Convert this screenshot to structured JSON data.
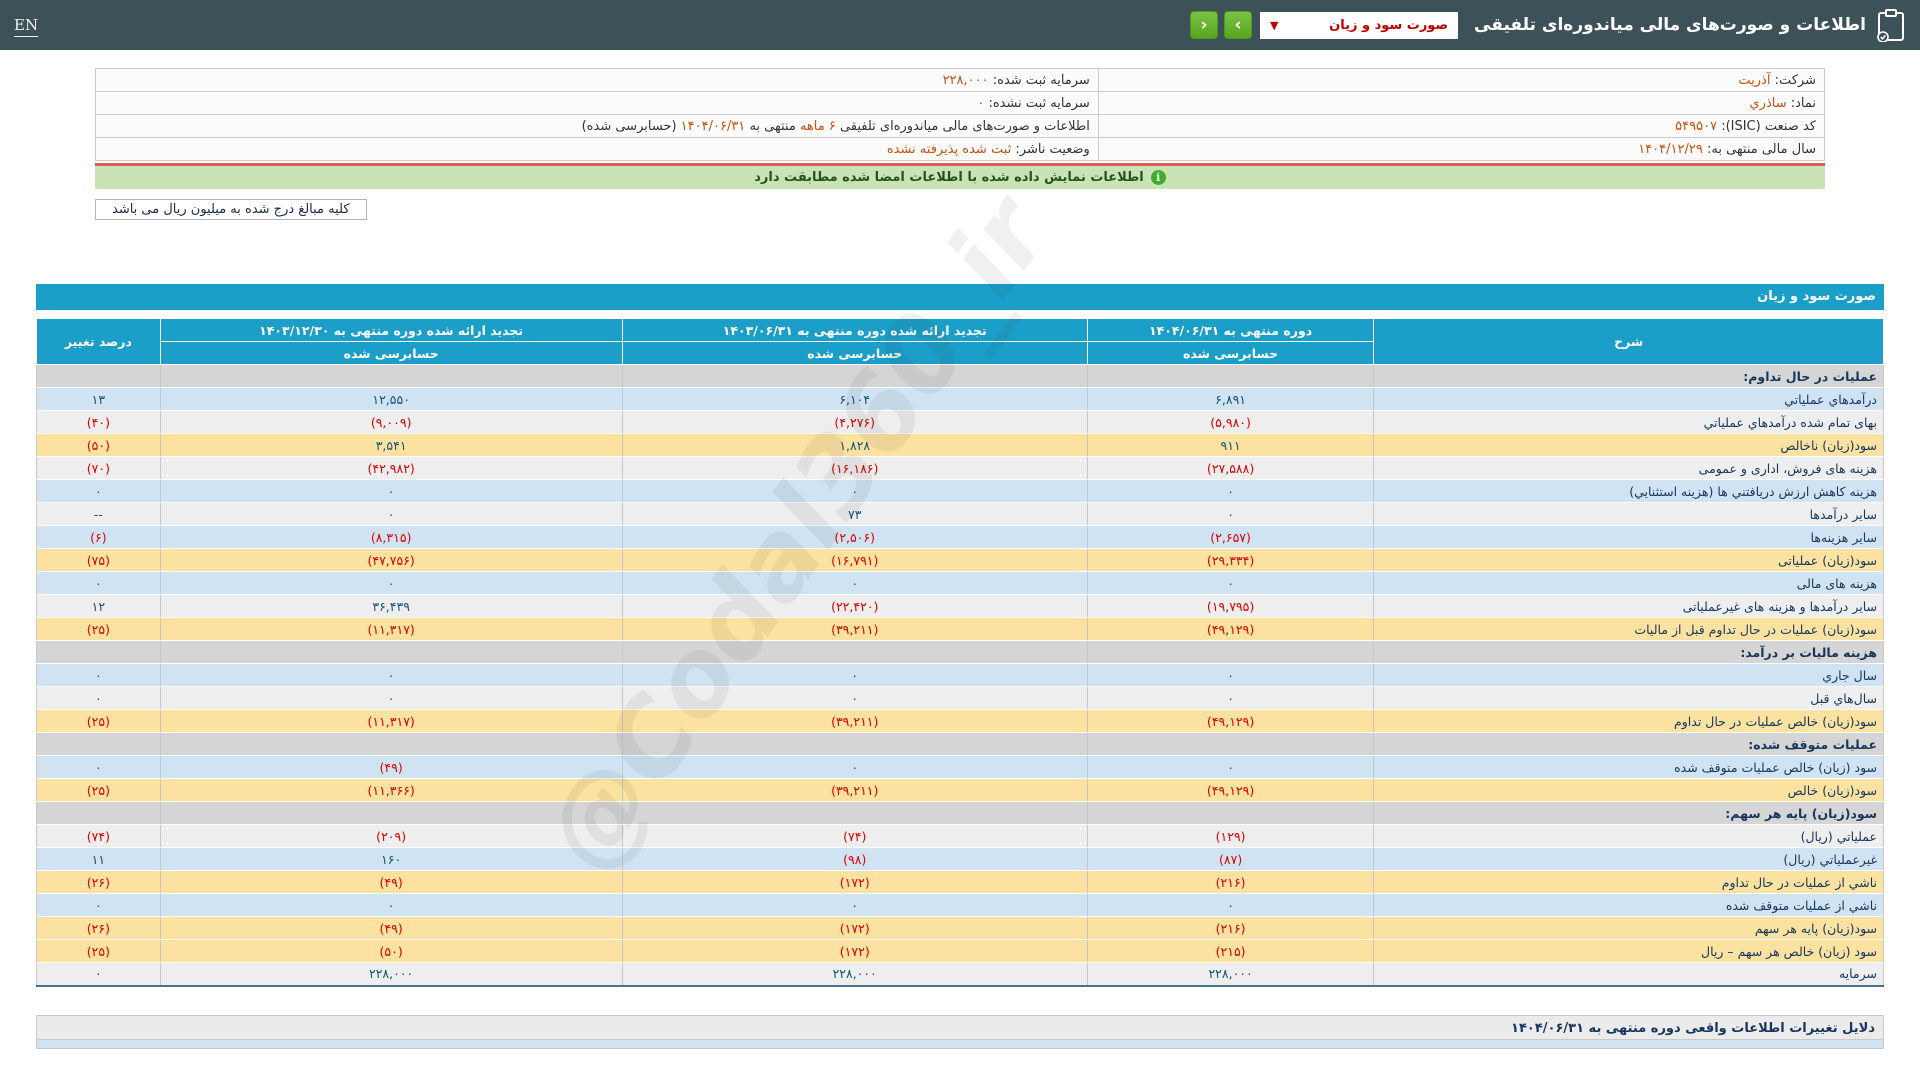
{
  "topbar": {
    "en_link": "EN",
    "title": "اطلاعات و صورت‌های مالی میاندوره‌ای تلفیقی",
    "statement_select": "صورت سود و زیان",
    "dropdown_arrow": "▼",
    "next_arrow": "›",
    "prev_arrow": "‹"
  },
  "info": {
    "company_label": "شرکت:",
    "company_value": "آذریت",
    "symbol_label": "نماد:",
    "symbol_value": "ساذري",
    "isic_label": "کد صنعت (ISIC):",
    "isic_value": "۵۴۹۵۰۷",
    "fiscal_year_label": "سال مالی منتهی به:",
    "fiscal_year_value": "۱۴۰۴/۱۲/۲۹",
    "registered_capital_label": "سرمایه ثبت شده:",
    "registered_capital_value": "۲۲۸,۰۰۰",
    "unregistered_capital_label": "سرمایه ثبت نشده:",
    "unregistered_capital_value": "۰",
    "report_title_prefix": "اطلاعات و صورت‌های مالی میاندوره‌ای تلفیقی",
    "report_period": "۶ ماهه",
    "report_mid": "منتهی به",
    "report_date": "۱۴۰۴/۰۶/۳۱",
    "report_suffix": "(حسابرسی شده)",
    "publisher_status_label": "وضعیت ناشر:",
    "publisher_status_value": "ثبت شده پذیرفته نشده"
  },
  "banner": {
    "info_icon": "i",
    "text": "اطلاعات نمایش داده شده با اطلاعات امضا شده مطابقت دارد"
  },
  "note": {
    "text": "کلیه مبالغ درج شده به میلیون ریال می باشد"
  },
  "watermark": "@Codal360_ir",
  "table": {
    "title": "صورت سود و زیان",
    "audited": "حسابرسی شده",
    "columns": {
      "description": "شرح",
      "current": "دوره منتهی به ۱۴۰۴/۰۶/۳۱",
      "restated_mid": "تجدید ارائه شده دوره منتهی به ۱۴۰۳/۰۶/۳۱",
      "restated_year": "تجدید ارائه شده دوره منتهی به ۱۴۰۳/۱۲/۳۰",
      "pct_change": "درصد تغییر"
    },
    "rows": [
      {
        "label": "عملیات در حال تداوم:",
        "v1": "",
        "v2": "",
        "v3": "",
        "pct": "",
        "variant": "section"
      },
      {
        "label": "درآمدهاي عملياتي",
        "v1": "۶,۸۹۱",
        "v2": "۶,۱۰۴",
        "v3": "۱۲,۵۵۰",
        "pct": "۱۳",
        "variant": "blue"
      },
      {
        "label": "بهای تمام شده درآمدهاي عملياتي",
        "v1": "(۵,۹۸۰)",
        "v2": "(۴,۲۷۶)",
        "v3": "(۹,۰۰۹)",
        "pct": "(۴۰)",
        "variant": "gray"
      },
      {
        "label": "سود(زيان) ناخالص",
        "v1": "۹۱۱",
        "v2": "۱,۸۲۸",
        "v3": "۳,۵۴۱",
        "pct": "(۵۰)",
        "variant": "yellow"
      },
      {
        "label": "هزينه های فروش، اداری و عمومی",
        "v1": "(۲۷,۵۸۸)",
        "v2": "(۱۶,۱۸۶)",
        "v3": "(۴۲,۹۸۲)",
        "pct": "(۷۰)",
        "variant": "gray"
      },
      {
        "label": "هزينه کاهش ارزش دريافتني ها (هزينه استثنايي)",
        "v1": "۰",
        "v2": "۰",
        "v3": "۰",
        "pct": "۰",
        "variant": "blue"
      },
      {
        "label": "ساير درآمدها",
        "v1": "۰",
        "v2": "۷۳",
        "v3": "۰",
        "pct": "--",
        "variant": "gray"
      },
      {
        "label": "ساير هزينه‌ها",
        "v1": "(۲,۶۵۷)",
        "v2": "(۲,۵۰۶)",
        "v3": "(۸,۳۱۵)",
        "pct": "(۶)",
        "variant": "blue"
      },
      {
        "label": "سود(زيان) عملياتی",
        "v1": "(۲۹,۳۳۴)",
        "v2": "(۱۶,۷۹۱)",
        "v3": "(۴۷,۷۵۶)",
        "pct": "(۷۵)",
        "variant": "yellow"
      },
      {
        "label": "هزينه های مالی",
        "v1": "۰",
        "v2": "۰",
        "v3": "۰",
        "pct": "۰",
        "variant": "blue"
      },
      {
        "label": "ساير درآمدها و هزينه های غيرعملياتی",
        "v1": "(۱۹,۷۹۵)",
        "v2": "(۲۲,۴۲۰)",
        "v3": "۳۶,۴۳۹",
        "pct": "۱۲",
        "variant": "gray"
      },
      {
        "label": "سود(زيان) عمليات در حال تداوم قبل از ماليات",
        "v1": "(۴۹,۱۲۹)",
        "v2": "(۳۹,۲۱۱)",
        "v3": "(۱۱,۳۱۷)",
        "pct": "(۲۵)",
        "variant": "yellow"
      },
      {
        "label": "هزينه ماليات بر درآمد:",
        "v1": "",
        "v2": "",
        "v3": "",
        "pct": "",
        "variant": "section"
      },
      {
        "label": "سال جاري",
        "v1": "۰",
        "v2": "۰",
        "v3": "۰",
        "pct": "۰",
        "variant": "blue"
      },
      {
        "label": "سال‌هاي قبل",
        "v1": "۰",
        "v2": "۰",
        "v3": "۰",
        "pct": "۰",
        "variant": "gray"
      },
      {
        "label": "سود(زيان) خالص عمليات در حال تداوم",
        "v1": "(۴۹,۱۲۹)",
        "v2": "(۳۹,۲۱۱)",
        "v3": "(۱۱,۳۱۷)",
        "pct": "(۲۵)",
        "variant": "yellow"
      },
      {
        "label": "عمليات متوقف شده:",
        "v1": "",
        "v2": "",
        "v3": "",
        "pct": "",
        "variant": "section"
      },
      {
        "label": "سود (زيان) خالص عمليات متوقف شده",
        "v1": "۰",
        "v2": "۰",
        "v3": "(۴۹)",
        "pct": "۰",
        "variant": "blue"
      },
      {
        "label": "سود(زيان) خالص",
        "v1": "(۴۹,۱۲۹)",
        "v2": "(۳۹,۲۱۱)",
        "v3": "(۱۱,۳۶۶)",
        "pct": "(۲۵)",
        "variant": "yellow"
      },
      {
        "label": "سود(زيان) پايه هر سهم:",
        "v1": "",
        "v2": "",
        "v3": "",
        "pct": "",
        "variant": "section"
      },
      {
        "label": "عملياتي (ريال)",
        "v1": "(۱۲۹)",
        "v2": "(۷۴)",
        "v3": "(۲۰۹)",
        "pct": "(۷۴)",
        "variant": "gray"
      },
      {
        "label": "غيرعملياتي (ريال)",
        "v1": "(۸۷)",
        "v2": "(۹۸)",
        "v3": "۱۶۰",
        "pct": "۱۱",
        "variant": "blue"
      },
      {
        "label": "ناشي از عمليات در حال تداوم",
        "v1": "(۲۱۶)",
        "v2": "(۱۷۲)",
        "v3": "(۴۹)",
        "pct": "(۲۶)",
        "variant": "yellow"
      },
      {
        "label": "ناشي از عمليات متوقف شده",
        "v1": "۰",
        "v2": "۰",
        "v3": "۰",
        "pct": "۰",
        "variant": "blue"
      },
      {
        "label": "سود(زيان) پايه هر سهم",
        "v1": "(۲۱۶)",
        "v2": "(۱۷۲)",
        "v3": "(۴۹)",
        "pct": "(۲۶)",
        "variant": "yellow"
      },
      {
        "label": "سود (زيان) خالص هر سهم – ريال",
        "v1": "(۲۱۵)",
        "v2": "(۱۷۲)",
        "v3": "(۵۰)",
        "pct": "(۲۵)",
        "variant": "yellow"
      },
      {
        "label": "سرمايه",
        "v1": "۲۲۸,۰۰۰",
        "v2": "۲۲۸,۰۰۰",
        "v3": "۲۲۸,۰۰۰",
        "pct": "۰",
        "variant": "gray"
      }
    ]
  },
  "reasons": {
    "header": "دلایل تغییرات اطلاعات واقعی دوره منتهی به ۱۴۰۴/۰۶/۳۱"
  },
  "colors": {
    "topbar_bg": "#3d5159",
    "accent_cyan": "#1b9fc8",
    "nav_green": "#5fae2b",
    "negative_red": "#e10000",
    "positive_blue": "#14537a",
    "value_orange": "#c9500e",
    "banner_green": "#c9e3b6",
    "row_blue": "#cfe3f3",
    "row_gray": "#eeeeee",
    "row_yellow": "#fbe2a0",
    "row_section": "#d5d5d5"
  }
}
